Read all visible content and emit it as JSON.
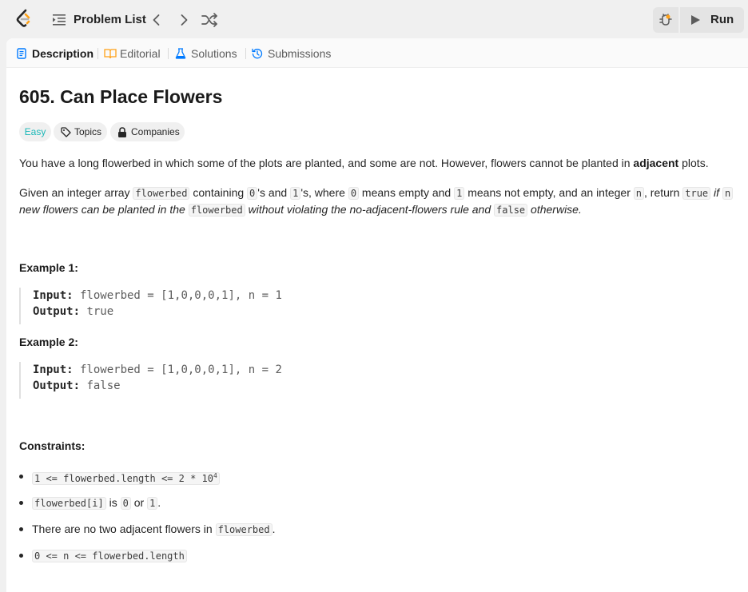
{
  "topbar": {
    "problem_list_label": "Problem List",
    "run_label": "Run",
    "icons": [
      "leetcode-logo-icon",
      "list-icon",
      "chevron-left-icon",
      "chevron-right-icon",
      "shuffle-icon",
      "debug-icon",
      "play-icon"
    ]
  },
  "tabs": [
    {
      "label": "Description",
      "active": true,
      "icon": "description-icon",
      "color": "#007aff"
    },
    {
      "label": "Editorial",
      "active": false,
      "icon": "book-icon",
      "color": "#ffa116"
    },
    {
      "label": "Solutions",
      "active": false,
      "icon": "flask-icon",
      "color": "#007aff"
    },
    {
      "label": "Submissions",
      "active": false,
      "icon": "history-icon",
      "color": "#007aff"
    }
  ],
  "problem": {
    "title": "605. Can Place Flowers",
    "difficulty": "Easy",
    "difficulty_color": "#1cb8b8",
    "topics_label": "Topics",
    "companies_label": "Companies",
    "desc1_pre": "You have a long flowerbed in which some of the plots are planted, and some are not. However, flowers cannot be planted in ",
    "desc1_bold": "adjacent",
    "desc1_post": " plots.",
    "desc2": {
      "t1": "Given an integer array ",
      "c1": "flowerbed",
      "t2": " containing ",
      "c2": "0",
      "t3": "'s and ",
      "c3": "1",
      "t4": "'s, where ",
      "c4": "0",
      "t5": " means empty and ",
      "c5": "1",
      "t6": " means not empty, and an integer ",
      "c6": "n",
      "t7": ", return ",
      "c7": "true",
      "t8": " if ",
      "c8": "n",
      "t9": "new flowers can be planted in the ",
      "c9": "flowerbed",
      "t10": " without violating the no-adjacent-flowers rule and ",
      "c10": "false",
      "t11": " otherwise."
    },
    "examples": [
      {
        "heading": "Example 1:",
        "input_label": "Input:",
        "input": " flowerbed = [1,0,0,0,1], n = 1",
        "output_label": "Output:",
        "output": " true"
      },
      {
        "heading": "Example 2:",
        "input_label": "Input:",
        "input": " flowerbed = [1,0,0,0,1], n = 2",
        "output_label": "Output:",
        "output": " false"
      }
    ],
    "constraints_heading": "Constraints:",
    "constraints": {
      "c1_code": "1 <= flowerbed.length <= 2 * 10",
      "c1_sup": "4",
      "c2_code": "flowerbed[i]",
      "c2_t1": " is ",
      "c2_c1": "0",
      "c2_t2": " or ",
      "c2_c2": "1",
      "c2_t3": ".",
      "c3_text": "There are no two adjacent flowers in ",
      "c3_code": "flowerbed",
      "c3_t2": ".",
      "c4_code": "0 <= n <= flowerbed.length"
    }
  }
}
